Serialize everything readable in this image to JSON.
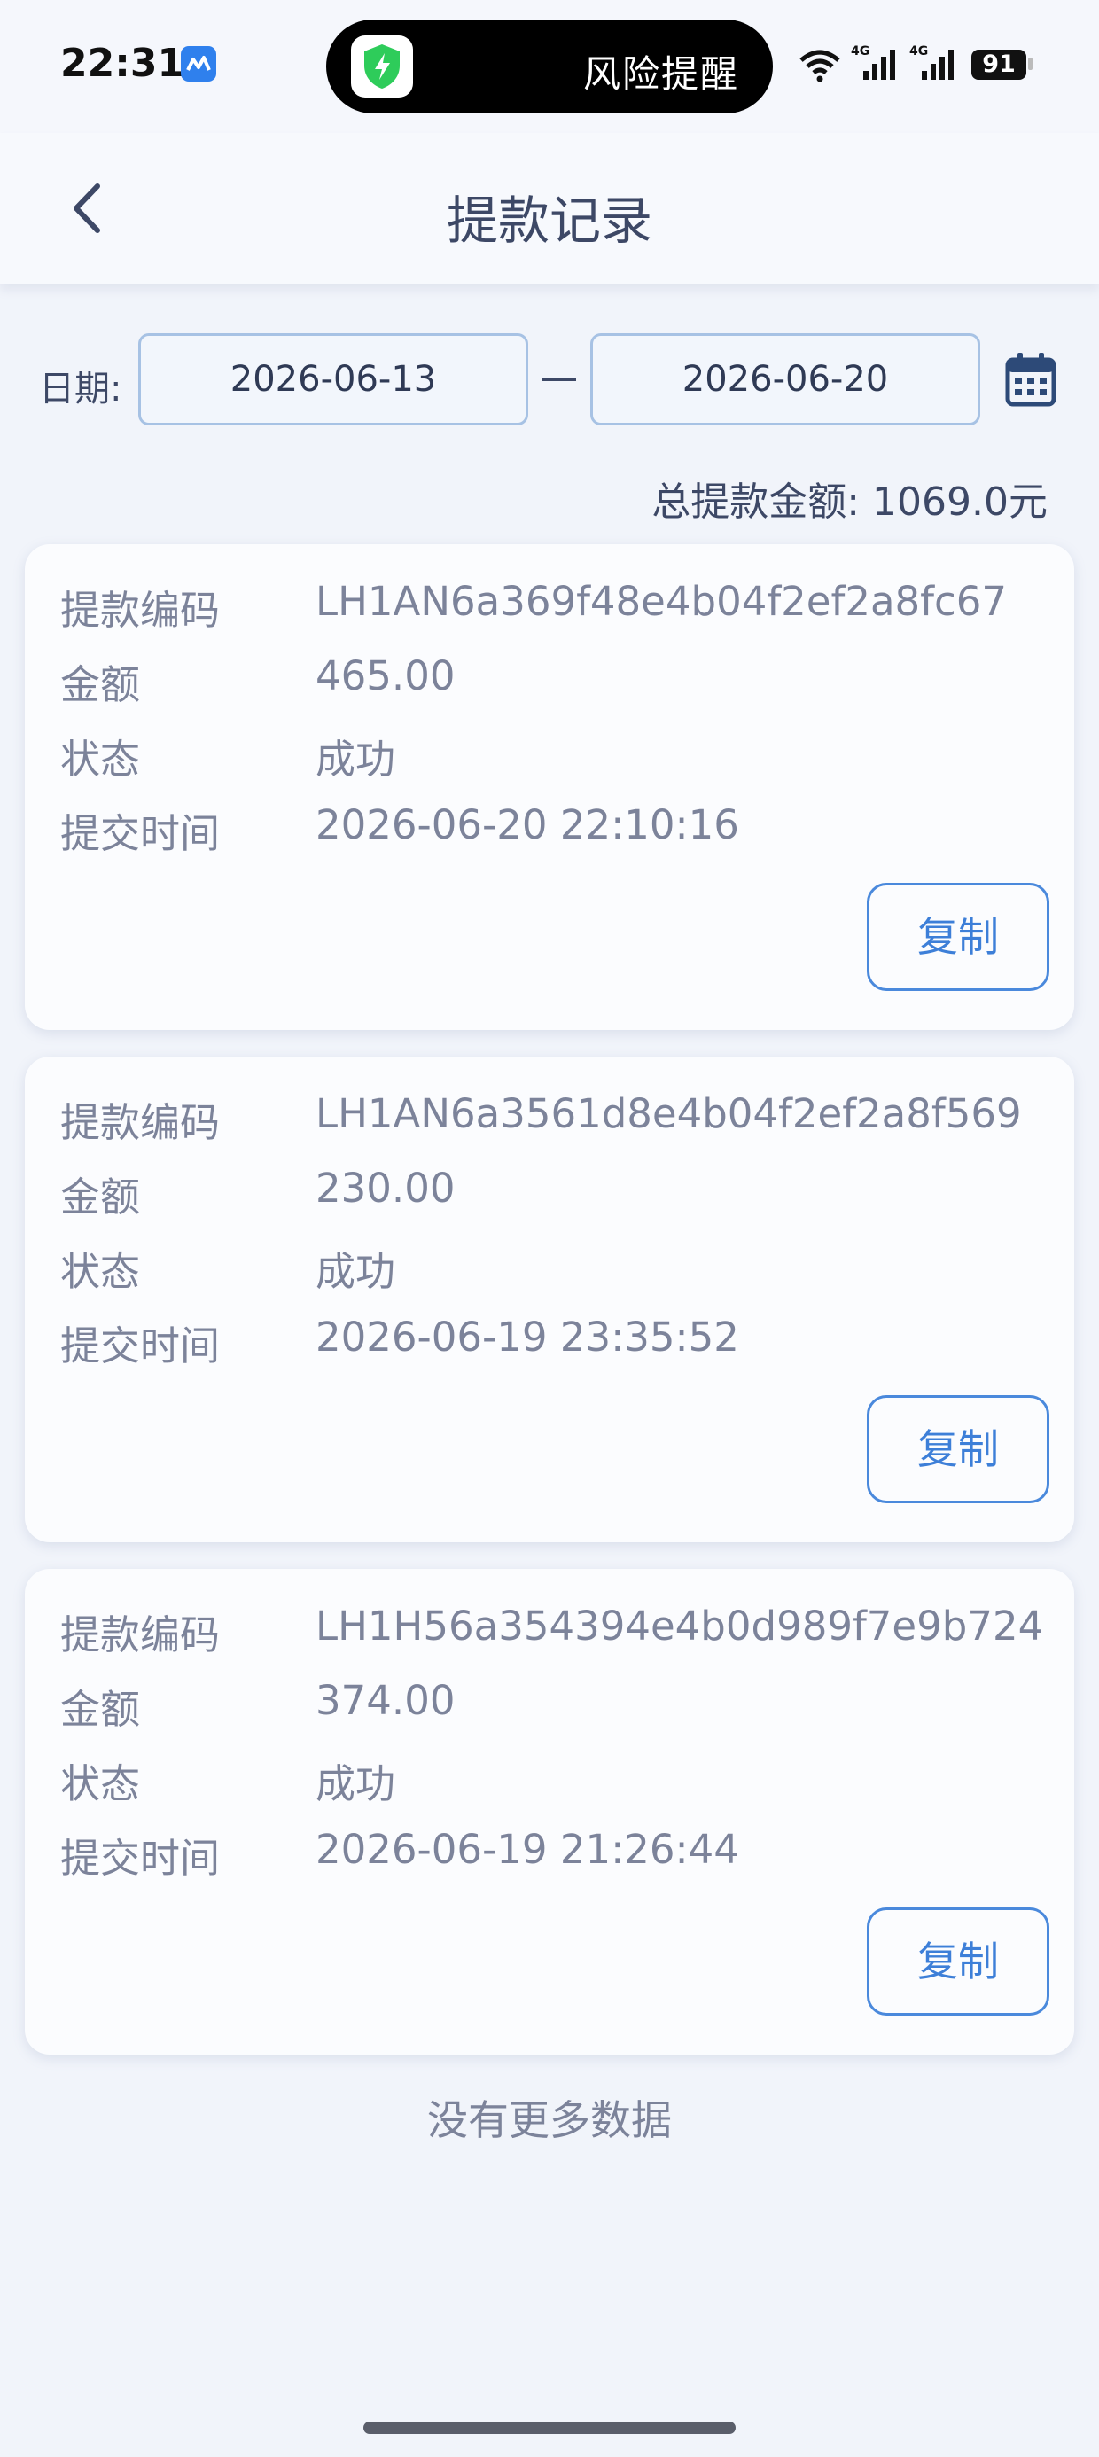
{
  "status_bar": {
    "time": "22:31",
    "app_badge_icon": "blue-app-icon",
    "island_icon": "green-shield-icon",
    "island_text": "风险提醒",
    "network_1": "4G",
    "network_2": "4G",
    "battery": "91"
  },
  "header": {
    "back_icon": "chevron-left-icon",
    "title": "提款记录"
  },
  "filter": {
    "date_label": "日期:",
    "start_date": "2026-06-13",
    "end_date": "2026-06-20",
    "calendar_icon": "calendar-icon"
  },
  "summary": {
    "total_text": "总提款金额: 1069.0元"
  },
  "labels": {
    "code": "提款编码",
    "amount": "金额",
    "status": "状态",
    "time": "提交时间",
    "copy": "复制"
  },
  "records": [
    {
      "code": "LH1AN6a369f48e4b04f2ef2a8fc67",
      "amount": "465.00",
      "status": "成功",
      "time": "2026-06-20 22:10:16"
    },
    {
      "code": "LH1AN6a3561d8e4b04f2ef2a8f569",
      "amount": "230.00",
      "status": "成功",
      "time": "2026-06-19 23:35:52"
    },
    {
      "code": "LH1H56a354394e4b0d989f7e9b724",
      "amount": "374.00",
      "status": "成功",
      "time": "2026-06-19 21:26:44"
    }
  ],
  "footer": {
    "no_more": "没有更多数据"
  },
  "colors": {
    "accent": "#3d7fd8",
    "background": "#f1f4fa",
    "card": "#fbfcfe",
    "text_primary": "#3d4866",
    "text_secondary": "#7c839a"
  }
}
